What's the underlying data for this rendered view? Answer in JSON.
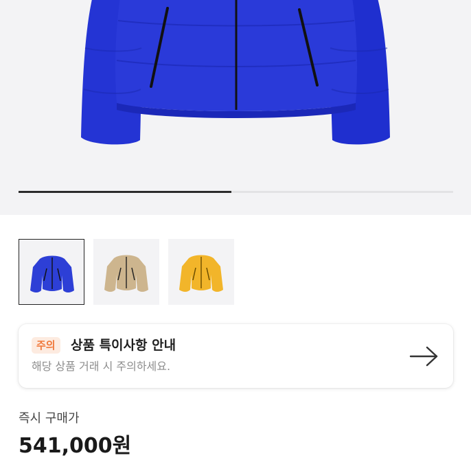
{
  "gallery": {
    "progress_fraction": 0.49,
    "thumbnails": [
      {
        "color": "blue",
        "hex": "#2d3fd6",
        "selected": true
      },
      {
        "color": "beige",
        "hex": "#cdb58e",
        "selected": false
      },
      {
        "color": "yellow",
        "hex": "#f2b52a",
        "selected": false
      }
    ]
  },
  "notice": {
    "badge": "주의",
    "title": "상품 특이사항 안내",
    "subtitle": "해당 상품 거래 시 주의하세요."
  },
  "purchase": {
    "label": "즉시 구매가",
    "price": "541,000원"
  },
  "colors": {
    "badge_bg": "#fdebe0",
    "badge_text": "#f0793c",
    "hero_bg": "#f3f3f5"
  }
}
